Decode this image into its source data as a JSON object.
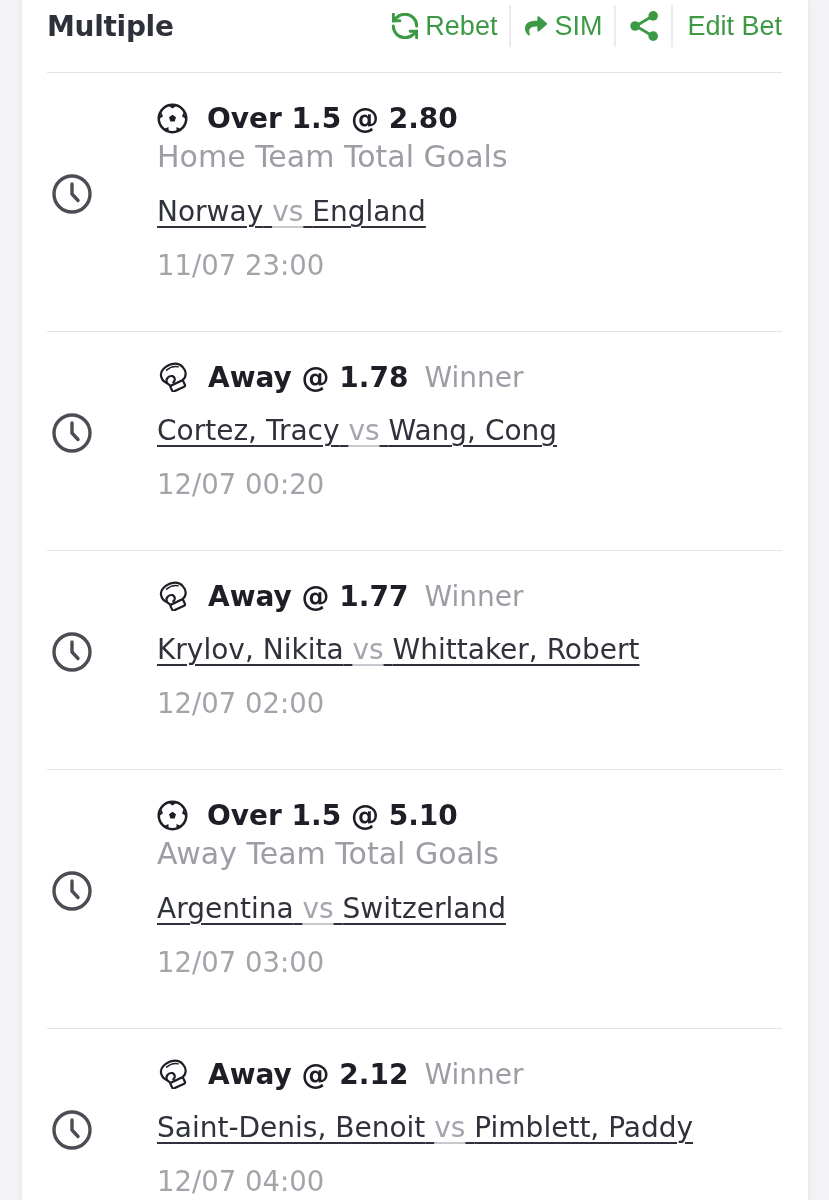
{
  "header": {
    "title": "Multiple",
    "actions": [
      {
        "kind": "rebet",
        "label": "Rebet"
      },
      {
        "kind": "sim",
        "label": "SIM"
      },
      {
        "kind": "share"
      },
      {
        "kind": "edit",
        "label": "Edit Bet"
      }
    ]
  },
  "legs": [
    {
      "kind": "football",
      "selection": "Over 1.5 @ 2.80",
      "market_below": "Home Team Total Goals",
      "home": "Norway",
      "vs": "vs",
      "away": "England",
      "date": "11/07 23:00"
    },
    {
      "kind": "mma",
      "selection": "Away @ 1.78",
      "market_inline": "Winner",
      "home": "Cortez, Tracy",
      "vs": "vs",
      "away": "Wang, Cong",
      "date": "12/07 00:20"
    },
    {
      "kind": "mma",
      "selection": "Away @ 1.77",
      "market_inline": "Winner",
      "home": "Krylov, Nikita",
      "vs": "vs",
      "away": "Whittaker, Robert",
      "date": "12/07 02:00"
    },
    {
      "kind": "football",
      "selection": "Over 1.5 @ 5.10",
      "market_below": "Away Team Total Goals",
      "home": "Argentina",
      "vs": "vs",
      "away": "Switzerland",
      "date": "12/07 03:00"
    },
    {
      "kind": "mma",
      "selection": "Away @ 2.12",
      "market_inline": "Winner",
      "home": "Saint-Denis, Benoit",
      "vs": "vs",
      "away": "Pimblett, Paddy",
      "date": "12/07 04:00"
    }
  ]
}
